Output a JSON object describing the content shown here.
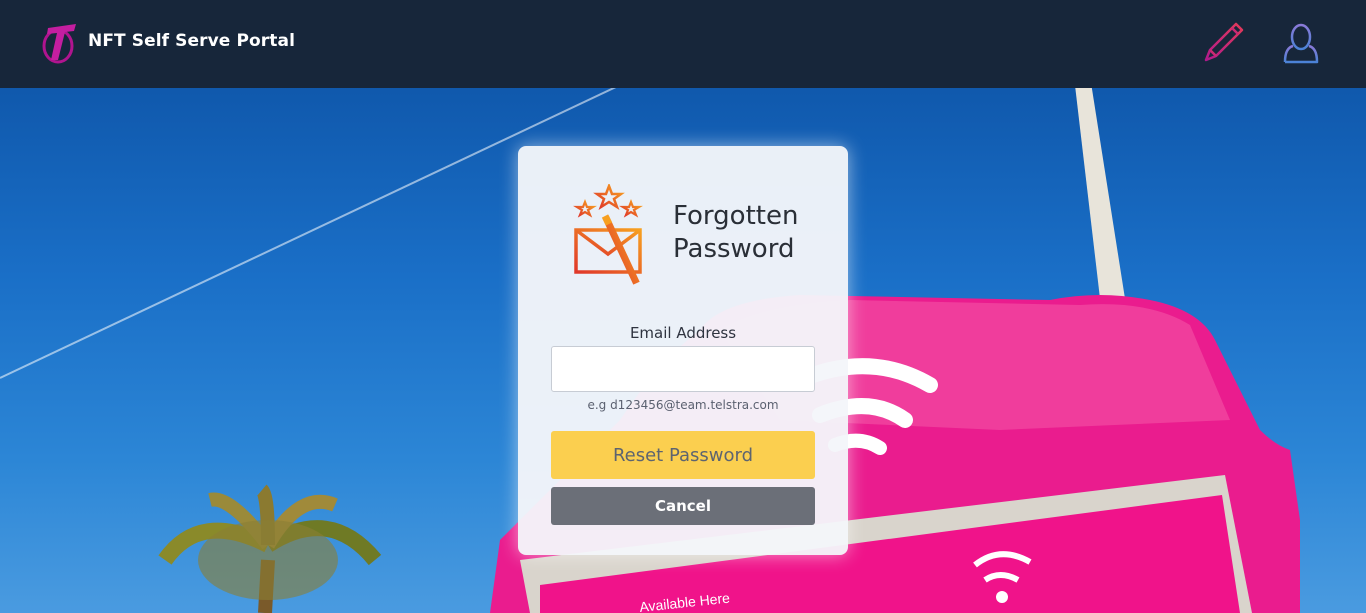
{
  "header": {
    "app_title": "NFT Self Serve Portal",
    "logo_icon": "telstra-logo-icon",
    "edit_icon": "pencil-icon",
    "user_icon": "user-icon"
  },
  "card": {
    "icon": "mail-stars-icon",
    "title": "Forgotten Password",
    "email_label": "Email Address",
    "email_value": "",
    "email_hint": "e.g d123456@team.telstra.com",
    "reset_label": "Reset Password",
    "cancel_label": "Cancel"
  },
  "background": {
    "sign_text": "Available Here"
  },
  "colors": {
    "header_bg": "#17263a",
    "reset_button": "#fbcf4f",
    "cancel_button": "#6b6f78",
    "brand_magenta": "#e6168c"
  }
}
